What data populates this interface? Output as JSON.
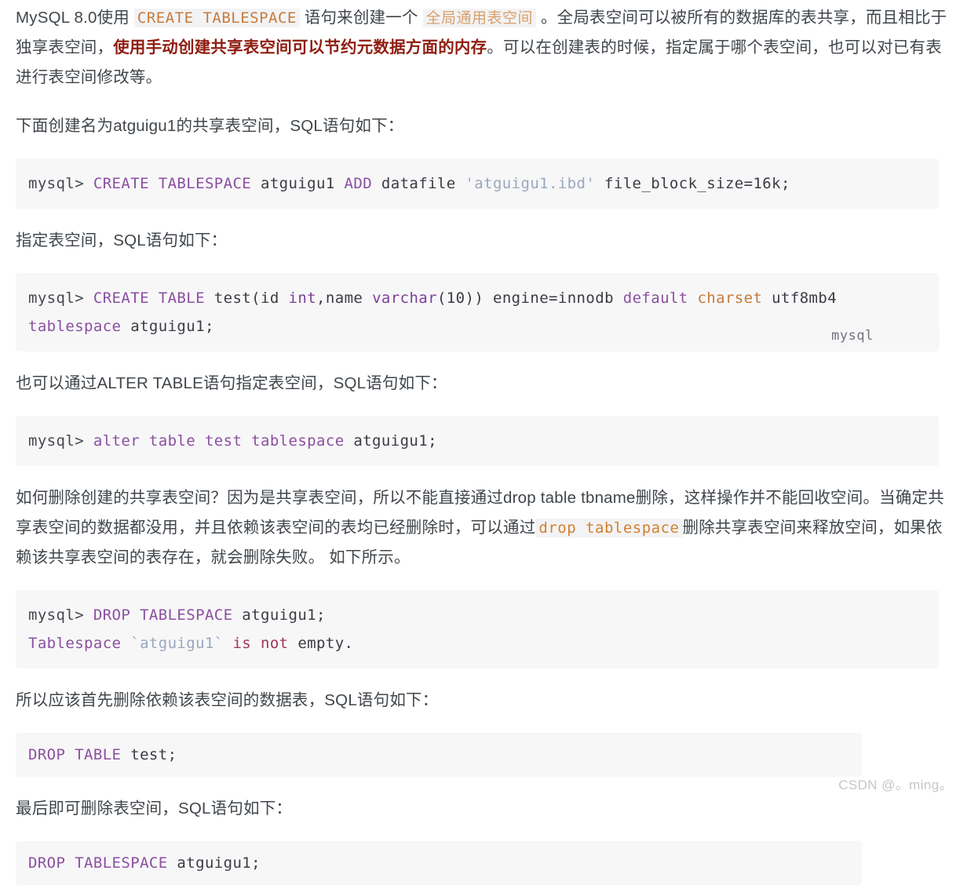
{
  "document": {
    "watermark": "CSDN @。ming。",
    "language_badge": "mysql",
    "paragraphs": {
      "p1_a": "MySQL 8.0使用 ",
      "p1_code1": "CREATE TABLESPACE",
      "p1_b": " 语句来创建一个 ",
      "p1_code2": "全局通用表空间",
      "p1_c": " 。全局表空间可以被所有的数据库的表共享，而且相比于独享表空间，",
      "p1_bold": "使用手动创建共享表空间可以节约元数据方面的内存",
      "p1_d": "。可以在创建表的时候，指定属于哪个表空间，也可以对已有表进行表空间修改等。",
      "p2": "下面创建名为atguigu1的共享表空间，SQL语句如下：",
      "p3": "指定表空间，SQL语句如下：",
      "p4": "也可以通过ALTER TABLE语句指定表空间，SQL语句如下：",
      "p5_a": "如何删除创建的共享表空间？因为是共享表空间，所以不能直接通过drop table tbname删除，这样操作并不能回收空间。当确定共享表空间的数据都没用，并且依赖该表空间的表均已经删除时，可以通过",
      "p5_code": "drop tablespace",
      "p5_b": "删除共享表空间来释放空间，如果依赖该共享表空间的表存在，就会删除失败。 如下所示。",
      "p6": "所以应该首先删除依赖该表空间的数据表，SQL语句如下：",
      "p7": "最后即可删除表空间，SQL语句如下："
    },
    "code_blocks": {
      "block1": {
        "line1": {
          "prompt": "mysql> ",
          "kw1": "CREATE TABLESPACE",
          "name1": " atguigu1 ",
          "kw2": "ADD",
          "name2": " datafile ",
          "str": "'atguigu1.ibd'",
          "tail": " file_block_size=16k;"
        }
      },
      "block2": {
        "line1": {
          "prompt": "mysql> ",
          "kw1": "CREATE TABLE",
          "t1": " test(id ",
          "kw2": "int",
          "t2": ",name ",
          "kw3": "varchar",
          "t3": "(10)) engine=innodb ",
          "kw4": "default",
          "t4": " ",
          "kw5": "charset",
          "t5": " utf8mb4"
        },
        "line2": {
          "kw1": "tablespace",
          "t1": " atguigu1;"
        }
      },
      "block3": {
        "line1": {
          "prompt": "mysql> ",
          "kw1": "alter table test tablespace",
          "t1": " atguigu1;"
        }
      },
      "block4": {
        "line1": {
          "prompt": "mysql> ",
          "kw1": "DROP TABLESPACE",
          "t1": " atguigu1;"
        },
        "line2": {
          "kw1": "Tablespace",
          "str": " `atguigu1`",
          "kw2": " is not",
          "t1": " empty."
        }
      },
      "block5": {
        "line1": {
          "kw1": "DROP TABLE",
          "t1": " test;"
        }
      },
      "block6": {
        "line1": {
          "kw1": "DROP TABLESPACE",
          "t1": " atguigu1;"
        }
      }
    }
  },
  "colors": {
    "text": "#41464b",
    "bold_red": "#8f1d11",
    "inline_code_orange": "#c77b3a",
    "inline_code_tan": "#d9a06a",
    "inline_code_drop": "#d4802e",
    "code_bg": "#f7f7f8",
    "keyword_purple": "#8b4f9f",
    "string_blue": "#9aa7bd",
    "attr_orange": "#c77b3a",
    "error_red": "#a3355a",
    "watermark": "#c6c6c8"
  }
}
